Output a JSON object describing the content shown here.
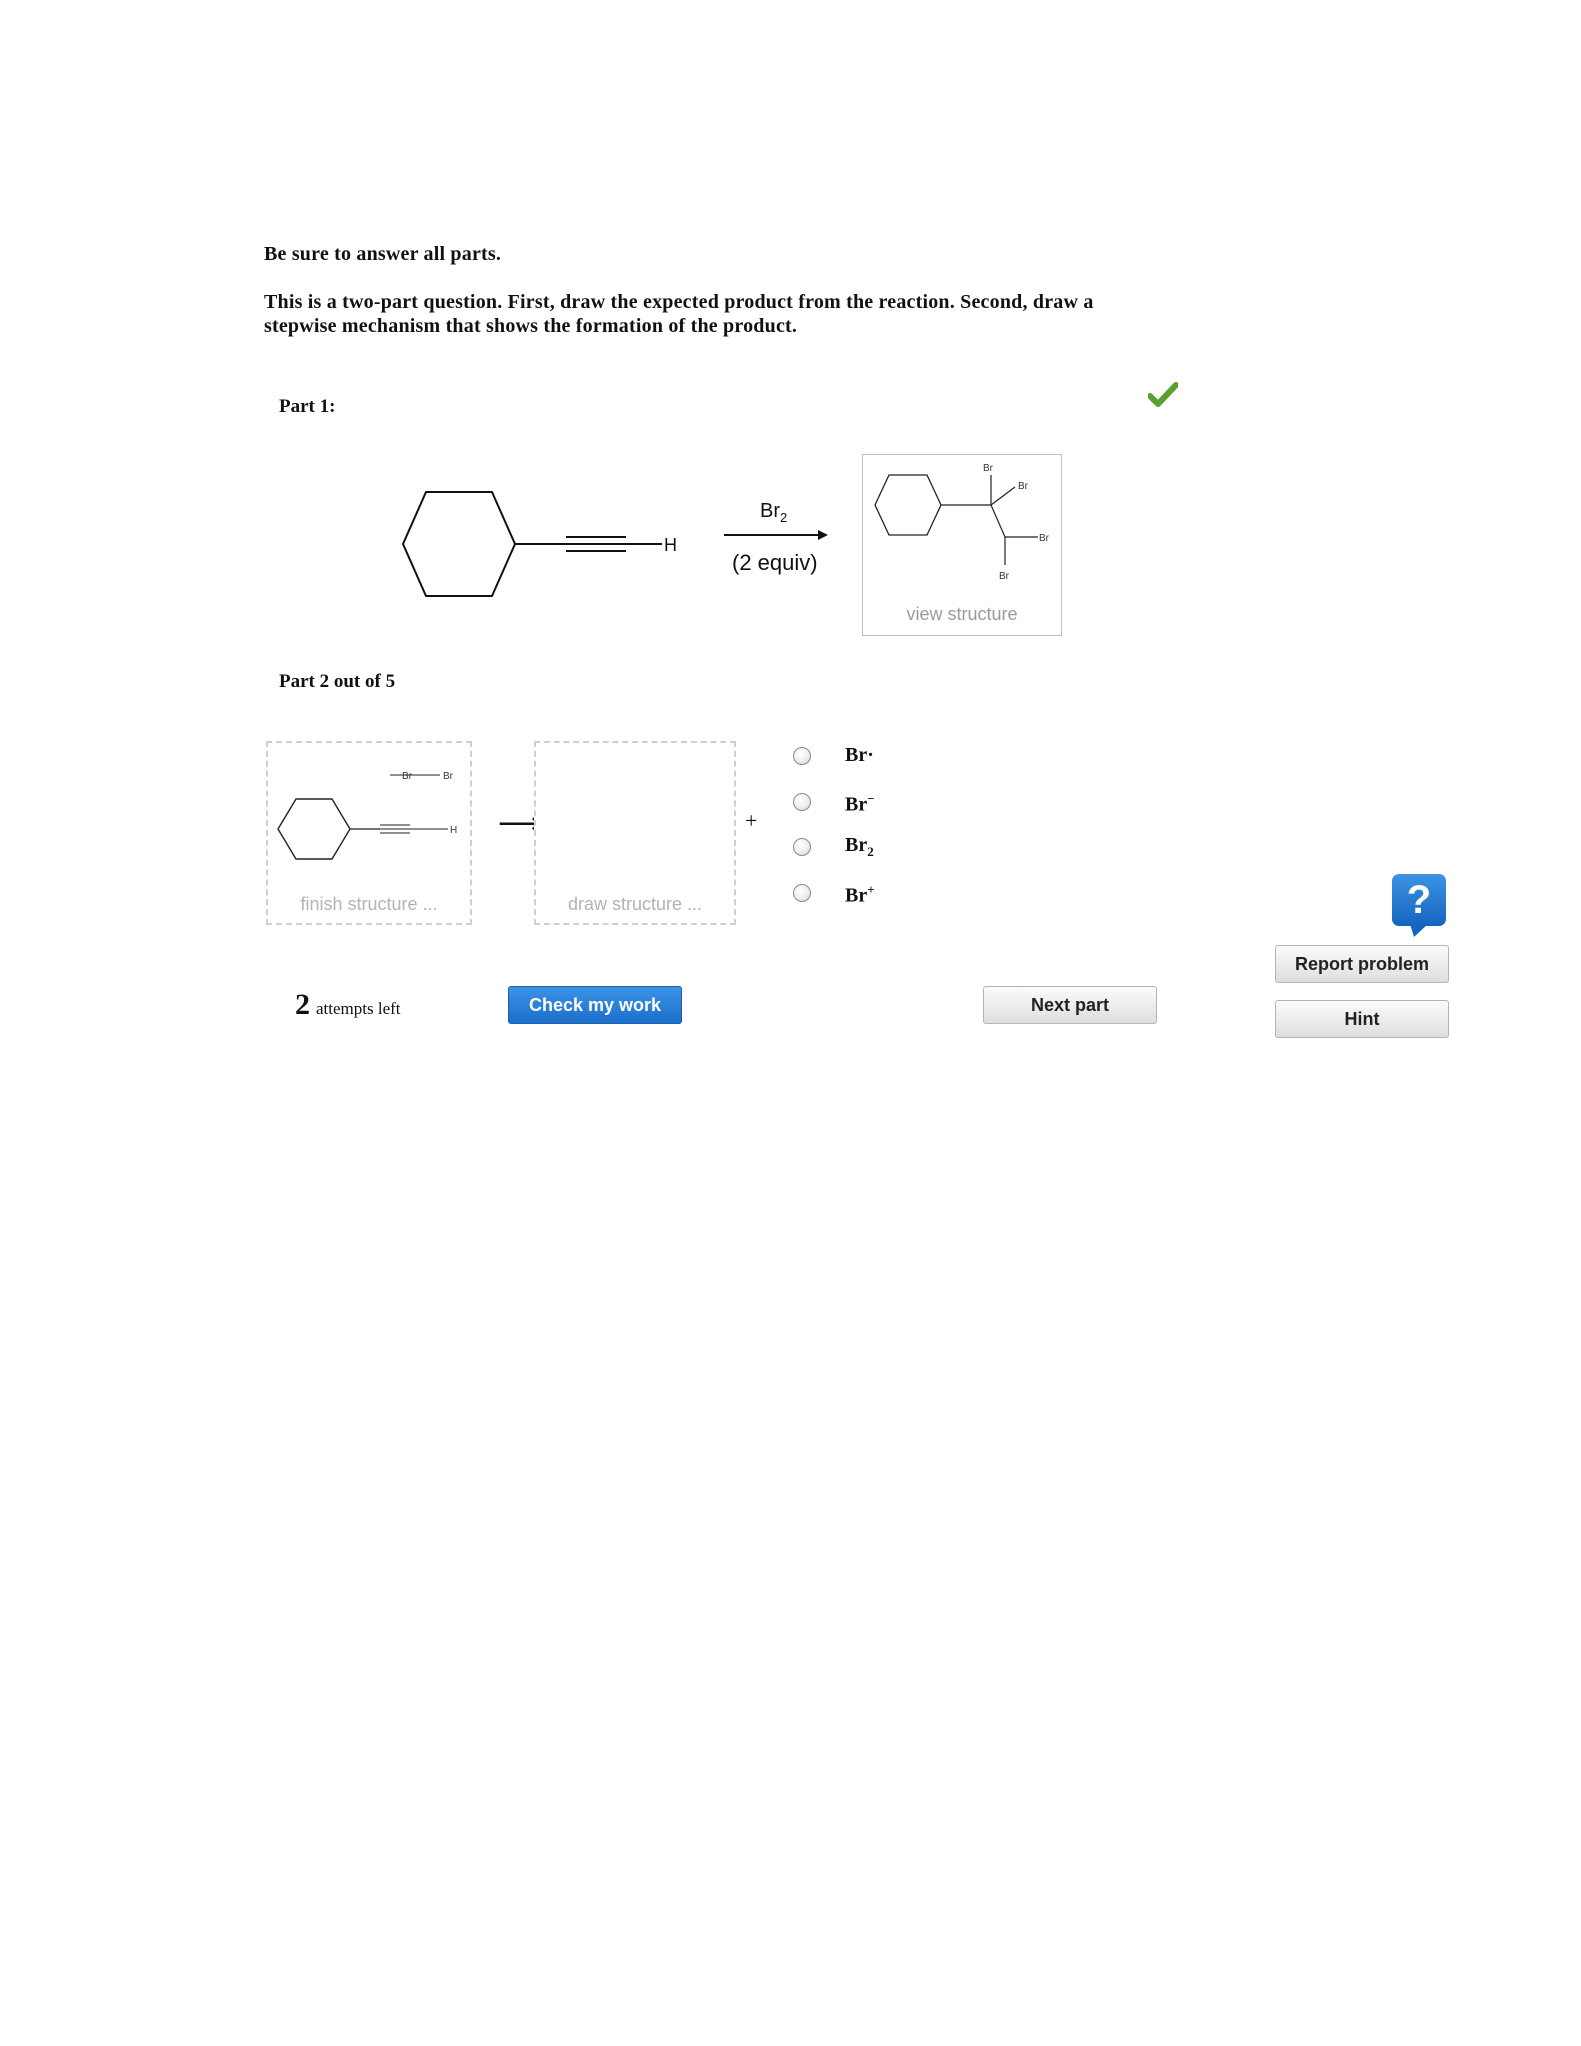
{
  "instructions": {
    "line1": "Be sure to answer all parts.",
    "line2": "This is a two-part question. First, draw the expected product from the reaction. Second, draw a stepwise mechanism that shows the formation of the product."
  },
  "part1": {
    "label": "Part 1:",
    "reactant_h": "H",
    "reagent": "Br",
    "reagent_sub": "2",
    "conditions": "(2 equiv)",
    "product_atoms": [
      "Br",
      "Br",
      "Br",
      "Br"
    ],
    "product_caption": "view structure",
    "status_icon": "checkmark-icon",
    "status_color": "#5aa02c"
  },
  "part2": {
    "label": "Part 2 out of 5",
    "box1": {
      "atom_br1": "Br",
      "atom_br2": "Br",
      "atom_h": "H",
      "caption": "finish structure ..."
    },
    "arrow": "⟶",
    "box2": {
      "caption": "draw structure ..."
    },
    "plus": "+",
    "options": [
      {
        "base": "Br",
        "mark": "·",
        "markType": "dot"
      },
      {
        "base": "Br",
        "mark": "−",
        "markType": "sup"
      },
      {
        "base": "Br",
        "mark": "2",
        "markType": "sub"
      },
      {
        "base": "Br",
        "mark": "+",
        "markType": "sup"
      }
    ]
  },
  "footer": {
    "attempts_count": "2",
    "attempts_text": "attempts left",
    "check_button": "Check my work",
    "next_button": "Next part",
    "report_button": "Report problem",
    "hint_button": "Hint",
    "help_icon": "?"
  },
  "colors": {
    "accent_blue": "#1c6fca",
    "check_green": "#5aa02c"
  }
}
